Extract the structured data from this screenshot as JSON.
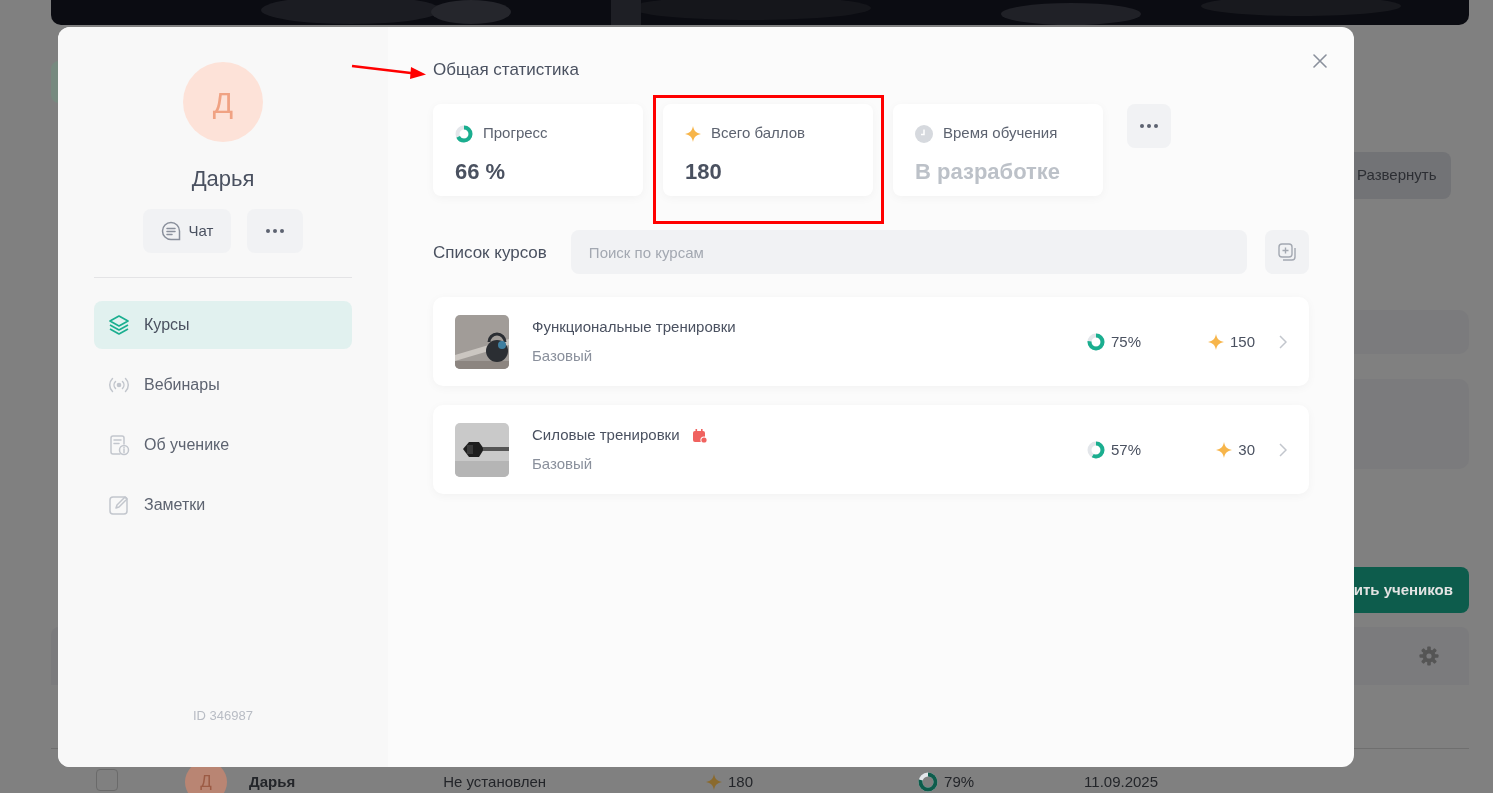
{
  "background_page": {
    "expand_button": "Развернуть",
    "add_students_button": "ить учеников",
    "student_row": {
      "checked": false,
      "avatar_letter": "Д",
      "name": "Дарья",
      "status": "Не установлен",
      "points": "180",
      "progress": "79%",
      "level": 0.79,
      "date": "11.09.2025"
    }
  },
  "profile": {
    "avatar_letter": "Д",
    "name": "Дарья",
    "chat_button": "Чат",
    "id": "ID 346987"
  },
  "sidebar": {
    "items": [
      {
        "label": "Курсы",
        "selected": true
      },
      {
        "label": "Вебинары",
        "selected": false
      },
      {
        "label": "Об ученике",
        "selected": false
      },
      {
        "label": "Заметки",
        "selected": false
      }
    ]
  },
  "stats": {
    "title": "Общая статистика",
    "cards": [
      {
        "kind": "progress",
        "label": "Прогресс",
        "value": "66 %",
        "level": 0.66,
        "highlighted": false,
        "disabled": false
      },
      {
        "kind": "points",
        "label": "Всего баллов",
        "value": "180",
        "highlighted": true,
        "disabled": false
      },
      {
        "kind": "time",
        "label": "Время обучения",
        "value": "В разработке",
        "highlighted": false,
        "disabled": true
      }
    ]
  },
  "annotation_arrow": true,
  "courses": {
    "title": "Список курсов",
    "search": {
      "placeholder": "Поиск по курсам"
    },
    "items": [
      {
        "title": "Функциональные тренировки",
        "tier": "Базовый",
        "scheduled": false,
        "progress": "75%",
        "level": 0.75,
        "points": "150"
      },
      {
        "title": "Силовые тренировки",
        "tier": "Базовый",
        "scheduled": true,
        "progress": "57%",
        "level": 0.57,
        "points": "30"
      }
    ]
  }
}
